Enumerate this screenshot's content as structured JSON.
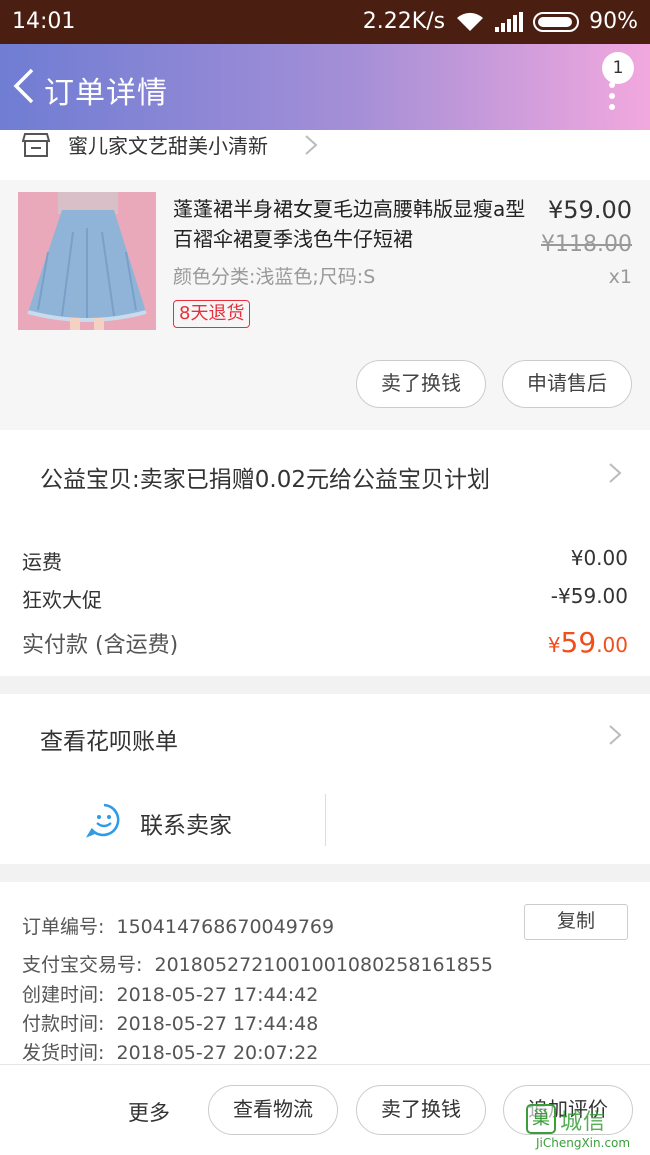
{
  "status_bar": {
    "time": "14:01",
    "network_speed": "2.22K/s",
    "battery": "90%",
    "icons": [
      "wifi-icon",
      "signal-icon",
      "battery-icon"
    ]
  },
  "header": {
    "title": "订单详情",
    "badge_count": "1",
    "gradient": [
      "#6f7dd3",
      "#f2a8de"
    ]
  },
  "shop": {
    "name": "蜜儿家文艺甜美小清新"
  },
  "product": {
    "title": "蓬蓬裙半身裙女夏毛边高腰韩版显瘦a型百褶伞裙夏季浅色牛仔短裙",
    "spec": "颜色分类:浅蓝色;尺码:S",
    "return_tag": "8天退货",
    "price": "¥59.00",
    "original_price": "¥118.00",
    "quantity": "x1",
    "buttons": {
      "resell": "卖了换钱",
      "after_sale": "申请售后"
    }
  },
  "charity": {
    "text": "公益宝贝:卖家已捐赠0.02元给公益宝贝计划"
  },
  "fees": {
    "shipping_label": "运费",
    "shipping_value": "¥0.00",
    "promo_label": "狂欢大促",
    "promo_value": "-¥59.00",
    "paid_label": "实付款 (含运费)",
    "paid_currency": "¥",
    "paid_int": "59",
    "paid_dec": ".00",
    "accent_color": "#f04e1a"
  },
  "huabei": {
    "label": "查看花呗账单"
  },
  "contact": {
    "label": "联系卖家"
  },
  "order_info": {
    "order_no_label": "订单编号:",
    "order_no": "150414768670049769",
    "copy_label": "复制",
    "alipay_label": "支付宝交易号:",
    "alipay_no": "2018052721001001080258161855",
    "created_label": "创建时间:",
    "created": "2018-05-27 17:44:42",
    "paid_time_label": "付款时间:",
    "paid_time": "2018-05-27 17:44:48",
    "shipped_label": "发货时间:",
    "shipped": "2018-05-27 20:07:22"
  },
  "bottom_bar": {
    "more": "更多",
    "logistics": "查看物流",
    "resell": "卖了换钱",
    "review": "追加评价"
  },
  "watermark": {
    "box_char": "巢",
    "cn": "城信",
    "en": "JiChengXin.com"
  }
}
